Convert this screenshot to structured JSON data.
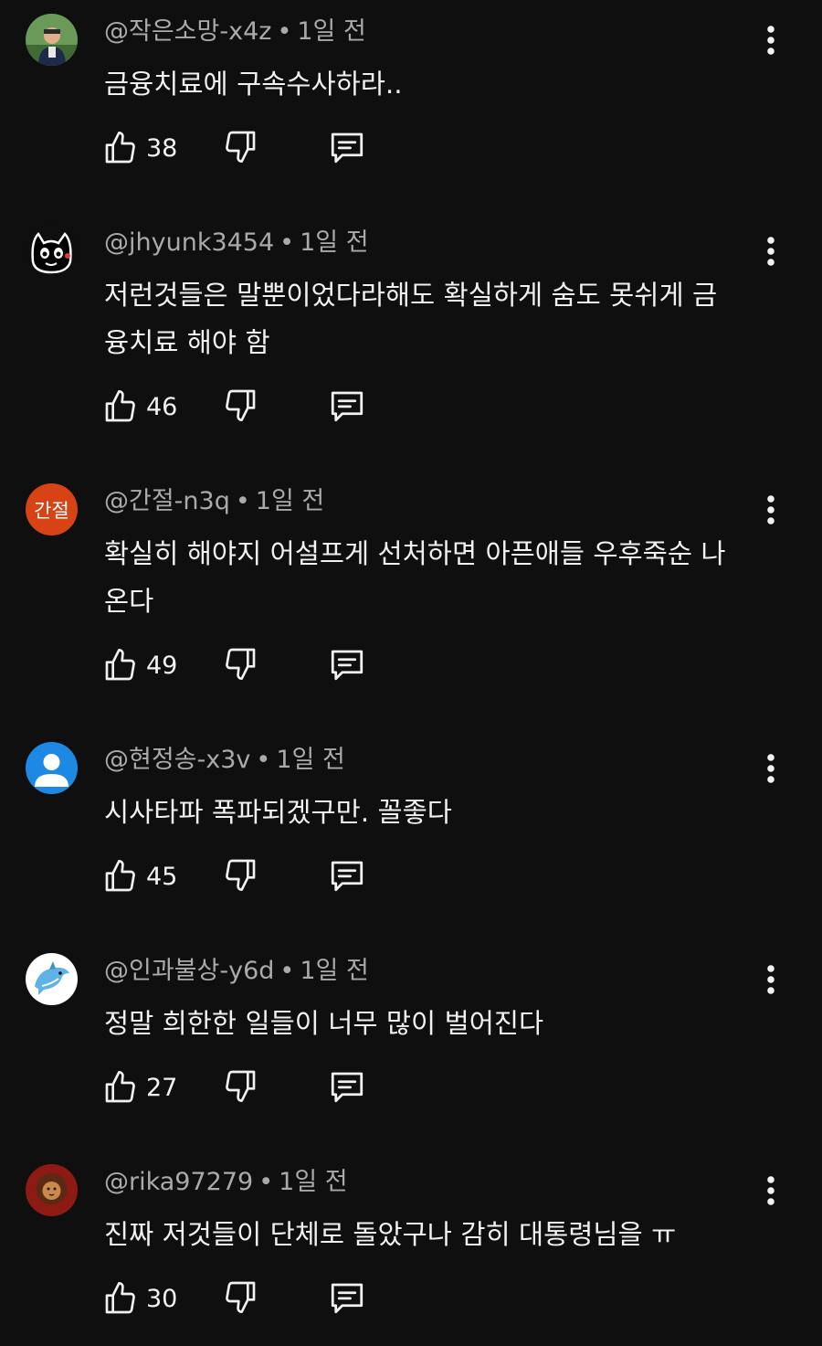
{
  "comments": [
    {
      "author": "@작은소망-x4z",
      "time": "1일 전",
      "text": "금융치료에 구속수사하라..",
      "likes": "38",
      "avatar": {
        "type": "photo-man",
        "colors": [
          "#5c8a4a",
          "#2f5a2a"
        ]
      }
    },
    {
      "author": "@jhyunk3454",
      "time": "1일 전",
      "text": "저런것들은 말뿐이었다라해도 확실하게 숨도 못쉬게 금융치료 해야 함",
      "likes": "46",
      "avatar": {
        "type": "cat-drawing",
        "colors": [
          "#000000",
          "#ffffff"
        ]
      }
    },
    {
      "author": "@간절-n3q",
      "time": "1일 전",
      "text": "확실히 해야지 어설프게 선처하면 아픈애들 우후죽순 나온다",
      "likes": "49",
      "avatar": {
        "type": "initials",
        "label": "간절",
        "colors": [
          "#d84315",
          "#ffffff"
        ]
      }
    },
    {
      "author": "@현정송-x3v",
      "time": "1일 전",
      "text": "시사타파 폭파되겠구만. 꼴좋다",
      "likes": "45",
      "avatar": {
        "type": "default-person",
        "colors": [
          "#1e88e5",
          "#ffffff"
        ]
      }
    },
    {
      "author": "@인과불상-y6d",
      "time": "1일 전",
      "text": "정말 희한한 일들이 너무 많이 벌어진다",
      "likes": "27",
      "avatar": {
        "type": "dolphin",
        "colors": [
          "#ffffff",
          "#5eb3e4"
        ]
      }
    },
    {
      "author": "@rika97279",
      "time": "1일 전",
      "text": "진짜 저것들이 단체로 돌았구나 감히 대통령님을 ㅠ",
      "likes": "30",
      "avatar": {
        "type": "lion",
        "colors": [
          "#b71c1c",
          "#3e2723"
        ]
      }
    }
  ],
  "separator": "•",
  "icons": {
    "like": "thumbs-up-icon",
    "dislike": "thumbs-down-icon",
    "reply": "reply-comment-icon",
    "more": "more-vertical-icon"
  },
  "colors": {
    "background": "#0f0f0f",
    "text": "#f1f1f1",
    "meta": "#aaaaaa"
  }
}
